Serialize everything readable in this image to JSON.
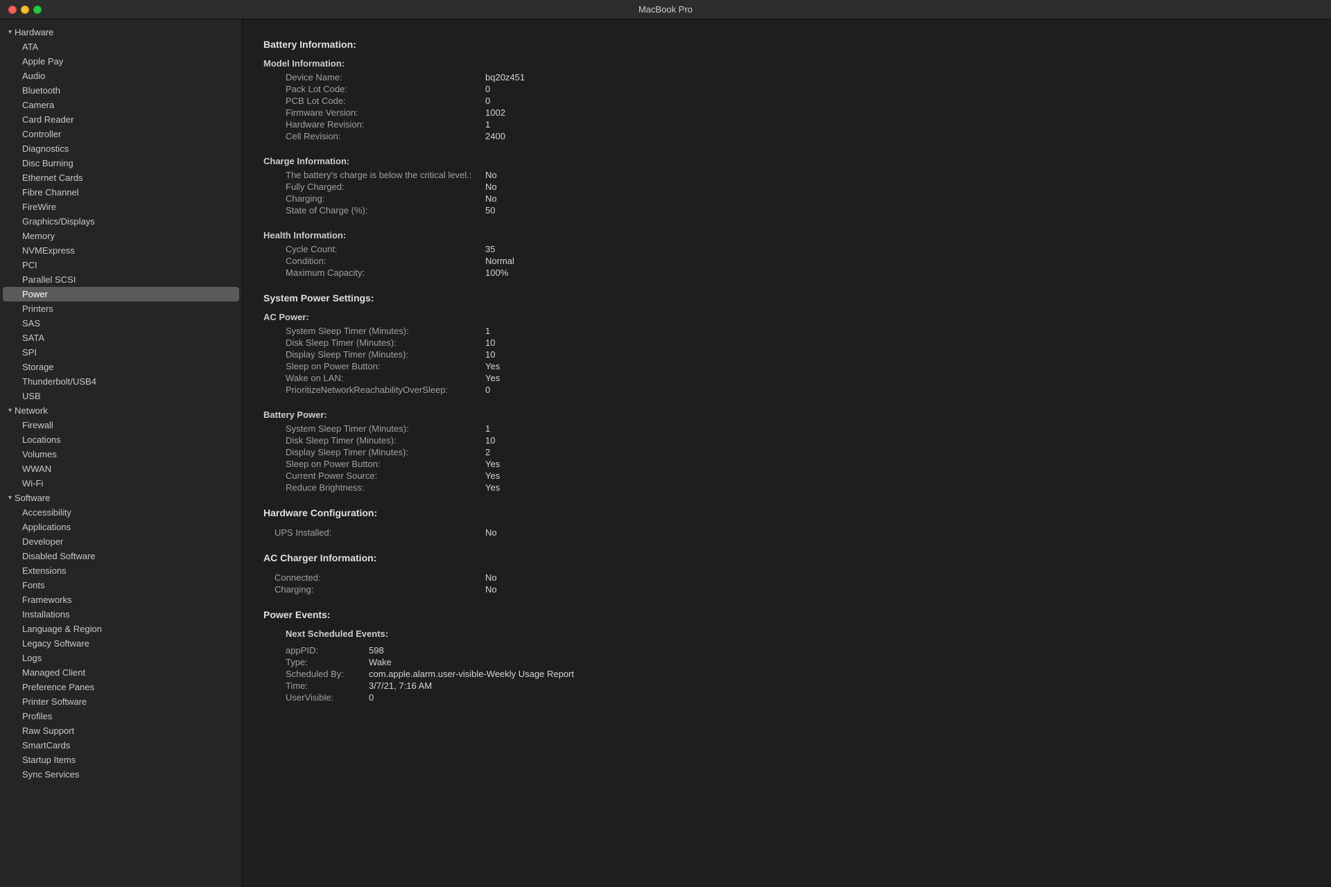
{
  "titleBar": {
    "title": "MacBook Pro"
  },
  "sidebar": {
    "hardware": {
      "label": "Hardware",
      "items": [
        {
          "id": "ata",
          "label": "ATA"
        },
        {
          "id": "apple-pay",
          "label": "Apple Pay"
        },
        {
          "id": "audio",
          "label": "Audio"
        },
        {
          "id": "bluetooth",
          "label": "Bluetooth"
        },
        {
          "id": "camera",
          "label": "Camera"
        },
        {
          "id": "card-reader",
          "label": "Card Reader"
        },
        {
          "id": "controller",
          "label": "Controller"
        },
        {
          "id": "diagnostics",
          "label": "Diagnostics"
        },
        {
          "id": "disc-burning",
          "label": "Disc Burning"
        },
        {
          "id": "ethernet-cards",
          "label": "Ethernet Cards"
        },
        {
          "id": "fibre-channel",
          "label": "Fibre Channel"
        },
        {
          "id": "firewire",
          "label": "FireWire"
        },
        {
          "id": "graphics-displays",
          "label": "Graphics/Displays"
        },
        {
          "id": "memory",
          "label": "Memory"
        },
        {
          "id": "nvmexpress",
          "label": "NVMExpress"
        },
        {
          "id": "pci",
          "label": "PCI"
        },
        {
          "id": "parallel-scsi",
          "label": "Parallel SCSI"
        },
        {
          "id": "power",
          "label": "Power",
          "selected": true
        },
        {
          "id": "printers",
          "label": "Printers"
        },
        {
          "id": "sas",
          "label": "SAS"
        },
        {
          "id": "sata",
          "label": "SATA"
        },
        {
          "id": "spi",
          "label": "SPI"
        },
        {
          "id": "storage",
          "label": "Storage"
        },
        {
          "id": "thunderbolt-usb4",
          "label": "Thunderbolt/USB4"
        },
        {
          "id": "usb",
          "label": "USB"
        }
      ]
    },
    "network": {
      "label": "Network",
      "items": [
        {
          "id": "firewall",
          "label": "Firewall"
        },
        {
          "id": "locations",
          "label": "Locations"
        },
        {
          "id": "volumes",
          "label": "Volumes"
        },
        {
          "id": "wwan",
          "label": "WWAN"
        },
        {
          "id": "wi-fi",
          "label": "Wi-Fi"
        }
      ]
    },
    "software": {
      "label": "Software",
      "items": [
        {
          "id": "accessibility",
          "label": "Accessibility"
        },
        {
          "id": "applications",
          "label": "Applications"
        },
        {
          "id": "developer",
          "label": "Developer"
        },
        {
          "id": "disabled-software",
          "label": "Disabled Software"
        },
        {
          "id": "extensions",
          "label": "Extensions"
        },
        {
          "id": "fonts",
          "label": "Fonts"
        },
        {
          "id": "frameworks",
          "label": "Frameworks"
        },
        {
          "id": "installations",
          "label": "Installations"
        },
        {
          "id": "language-region",
          "label": "Language & Region"
        },
        {
          "id": "legacy-software",
          "label": "Legacy Software"
        },
        {
          "id": "logs",
          "label": "Logs"
        },
        {
          "id": "managed-client",
          "label": "Managed Client"
        },
        {
          "id": "preference-panes",
          "label": "Preference Panes"
        },
        {
          "id": "printer-software",
          "label": "Printer Software"
        },
        {
          "id": "profiles",
          "label": "Profiles"
        },
        {
          "id": "raw-support",
          "label": "Raw Support"
        },
        {
          "id": "smartcards",
          "label": "SmartCards"
        },
        {
          "id": "startup-items",
          "label": "Startup Items"
        },
        {
          "id": "sync-services",
          "label": "Sync Services"
        }
      ]
    }
  },
  "content": {
    "pageTitle": "Battery Information:",
    "modelInfo": {
      "title": "Model Information:",
      "rows": [
        {
          "label": "Device Name:",
          "value": "bq20z451"
        },
        {
          "label": "Pack Lot Code:",
          "value": "0"
        },
        {
          "label": "PCB Lot Code:",
          "value": "0"
        },
        {
          "label": "Firmware Version:",
          "value": "1002"
        },
        {
          "label": "Hardware Revision:",
          "value": "1"
        },
        {
          "label": "Cell Revision:",
          "value": "2400"
        }
      ]
    },
    "chargeInfo": {
      "title": "Charge Information:",
      "rows": [
        {
          "label": "The battery's charge is below the critical level.:",
          "value": "No"
        },
        {
          "label": "Fully Charged:",
          "value": "No"
        },
        {
          "label": "Charging:",
          "value": "No"
        },
        {
          "label": "State of Charge (%):",
          "value": "50"
        }
      ]
    },
    "healthInfo": {
      "title": "Health Information:",
      "rows": [
        {
          "label": "Cycle Count:",
          "value": "35"
        },
        {
          "label": "Condition:",
          "value": "Normal"
        },
        {
          "label": "Maximum Capacity:",
          "value": "100%"
        }
      ]
    },
    "systemPowerTitle": "System Power Settings:",
    "acPower": {
      "title": "AC Power:",
      "rows": [
        {
          "label": "System Sleep Timer (Minutes):",
          "value": "1"
        },
        {
          "label": "Disk Sleep Timer (Minutes):",
          "value": "10"
        },
        {
          "label": "Display Sleep Timer (Minutes):",
          "value": "10"
        },
        {
          "label": "Sleep on Power Button:",
          "value": "Yes"
        },
        {
          "label": "Wake on LAN:",
          "value": "Yes"
        },
        {
          "label": "PrioritizeNetworkReachabilityOverSleep:",
          "value": "0"
        }
      ]
    },
    "batteryPower": {
      "title": "Battery Power:",
      "rows": [
        {
          "label": "System Sleep Timer (Minutes):",
          "value": "1"
        },
        {
          "label": "Disk Sleep Timer (Minutes):",
          "value": "10"
        },
        {
          "label": "Display Sleep Timer (Minutes):",
          "value": "2"
        },
        {
          "label": "Sleep on Power Button:",
          "value": "Yes"
        },
        {
          "label": "Current Power Source:",
          "value": "Yes"
        },
        {
          "label": "Reduce Brightness:",
          "value": "Yes"
        }
      ]
    },
    "hardwareConfigTitle": "Hardware Configuration:",
    "hardwareConfig": {
      "rows": [
        {
          "label": "UPS Installed:",
          "value": "No"
        }
      ]
    },
    "acChargerTitle": "AC Charger Information:",
    "acCharger": {
      "rows": [
        {
          "label": "Connected:",
          "value": "No"
        },
        {
          "label": "Charging:",
          "value": "No"
        }
      ]
    },
    "powerEventsTitle": "Power Events:",
    "powerEvents": {
      "nextScheduledTitle": "Next Scheduled Events:",
      "event": {
        "appPID": {
          "label": "appPID:",
          "value": "598"
        },
        "type": {
          "label": "Type:",
          "value": "Wake"
        },
        "scheduledBy": {
          "label": "Scheduled By:",
          "value": "com.apple.alarm.user-visible-Weekly Usage Report"
        },
        "time": {
          "label": "Time:",
          "value": "3/7/21, 7:16 AM"
        },
        "userVisible": {
          "label": "UserVisible:",
          "value": "0"
        }
      }
    }
  }
}
